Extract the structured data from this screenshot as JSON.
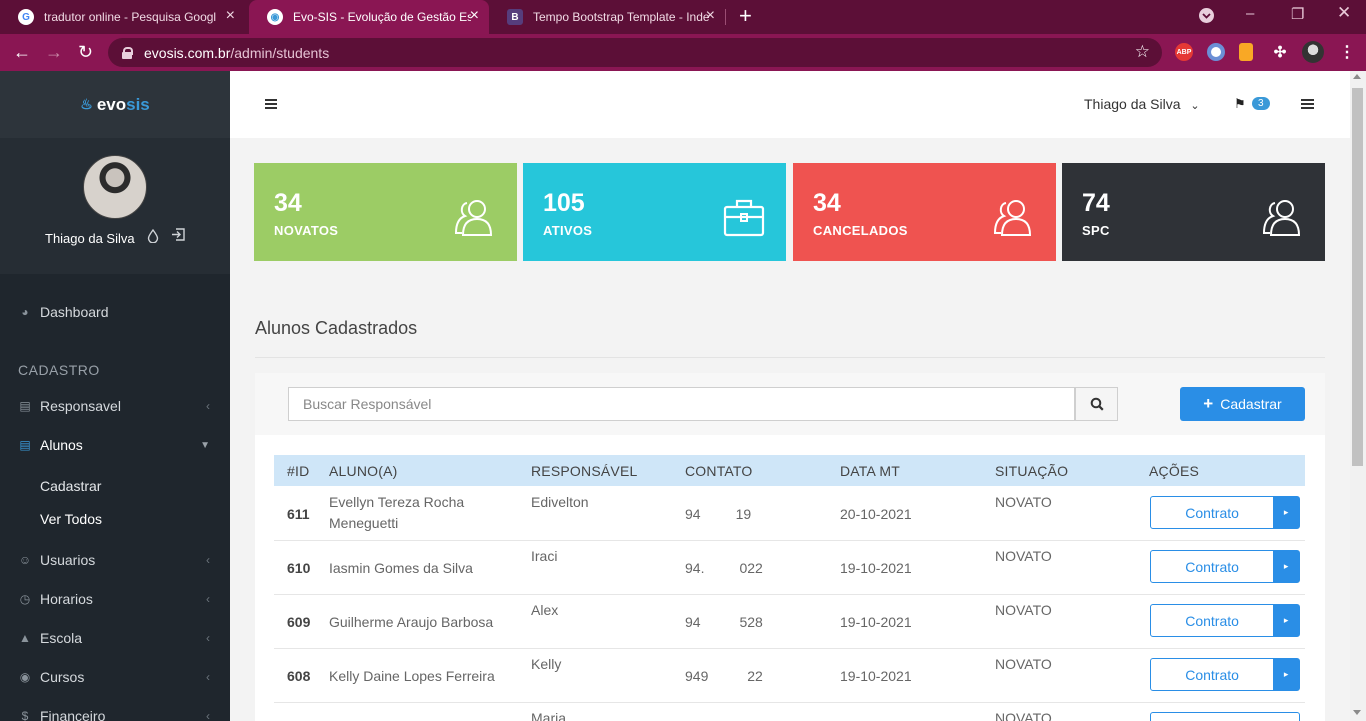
{
  "browser": {
    "tabs": [
      {
        "title": "tradutor online - Pesquisa Googl",
        "icon": "google-icon"
      },
      {
        "title": "Evo-SIS - Evolução de Gestão Esc",
        "icon": "evosis-favicon"
      },
      {
        "title": "Tempo Bootstrap Template - Inde",
        "icon": "bootstrap-icon"
      }
    ],
    "url_host": "evosis.com.br",
    "url_path": "/admin/students",
    "extensions": {
      "abp": "ABP"
    }
  },
  "sidebar": {
    "brand_evo": "evo",
    "brand_sis": "sis",
    "user_name": "Thiago da Silva",
    "dashboard": "Dashboard",
    "section": "CADASTRO",
    "items": [
      "Responsavel",
      "Alunos",
      "Usuarios",
      "Horarios",
      "Escola",
      "Cursos",
      "Financeiro"
    ],
    "sub_items": [
      "Cadastrar",
      "Ver Todos"
    ]
  },
  "header": {
    "user_name": "Thiago da Silva",
    "notification_count": "3"
  },
  "stats": [
    {
      "value": "34",
      "label": "NOVATOS",
      "color": "#9ccc65"
    },
    {
      "value": "105",
      "label": "ATIVOS",
      "color": "#26c6da"
    },
    {
      "value": "34",
      "label": "CANCELADOS",
      "color": "#ef5350"
    },
    {
      "value": "74",
      "label": "SPC",
      "color": "#2f3237"
    }
  ],
  "main": {
    "title": "Alunos Cadastrados",
    "search_placeholder": "Buscar Responsável",
    "add_button": "Cadastrar",
    "columns": [
      "#ID",
      "ALUNO(A)",
      "RESPONSÁVEL",
      "CONTATO",
      "DATA MT",
      "SITUAÇÃO",
      "AÇÕES"
    ],
    "rows": [
      {
        "id": "611",
        "student_line1": "Evellyn Tereza Rocha",
        "student_line2": "Meneguetti",
        "guardian": "Edivelton",
        "contact": "94         19",
        "date": "20-10-2021",
        "status": "NOVATO",
        "action": "Contrato"
      },
      {
        "id": "610",
        "student_line1": "Iasmin Gomes da Silva",
        "student_line2": "",
        "guardian": "Iraci",
        "contact": "94.         022",
        "date": "19-10-2021",
        "status": "NOVATO",
        "action": "Contrato"
      },
      {
        "id": "609",
        "student_line1": "Guilherme Araujo Barbosa",
        "student_line2": "",
        "guardian": "Alex",
        "contact": "94          528",
        "date": "19-10-2021",
        "status": "NOVATO",
        "action": "Contrato"
      },
      {
        "id": "608",
        "student_line1": "Kelly Daine Lopes Ferreira",
        "student_line2": "",
        "guardian": "Kelly",
        "contact": "949          22",
        "date": "19-10-2021",
        "status": "NOVATO",
        "action": "Contrato"
      },
      {
        "id": "",
        "student_line1": "",
        "student_line2": "",
        "guardian": "Maria",
        "contact": "",
        "date": "",
        "status": "NOVATO",
        "action": ""
      }
    ]
  },
  "colors": {
    "primary": "#2a8ee6",
    "sidebar": "#1f262d",
    "browser": "#8a1653"
  }
}
